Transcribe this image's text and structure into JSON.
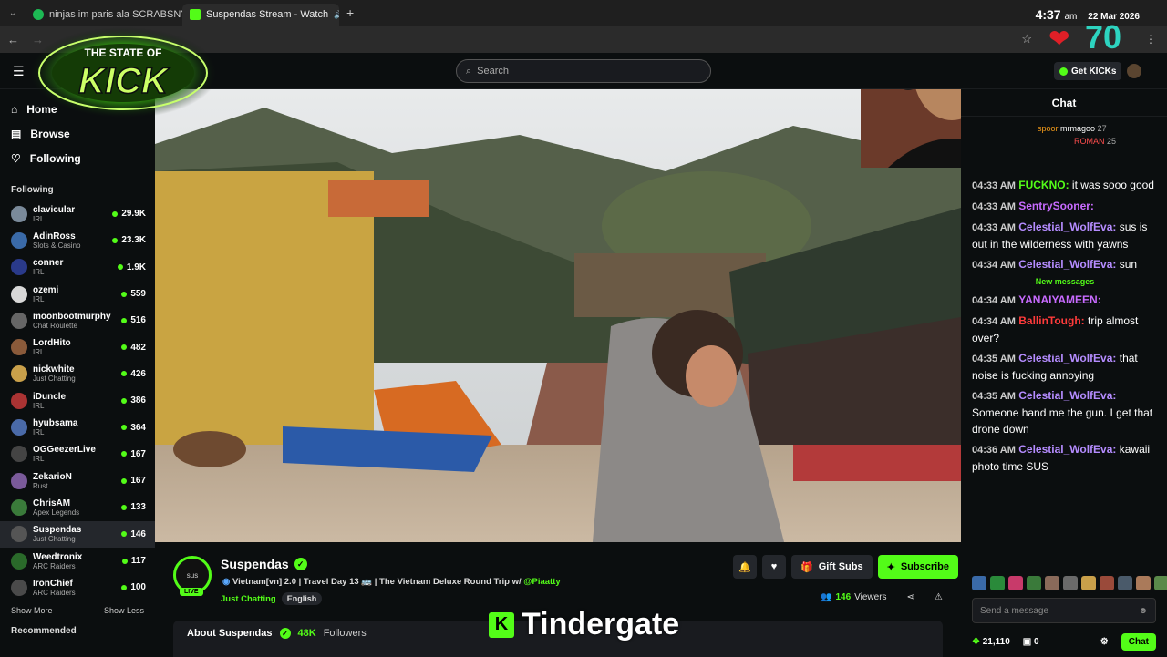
{
  "browser": {
    "tabs": [
      {
        "label": "ninjas im paris ala SCRABSNYC",
        "active": false
      },
      {
        "label": "Suspendas Stream - Watch",
        "active": true
      }
    ],
    "new_tab": "+"
  },
  "overlay": {
    "clock_time": "4:37",
    "clock_ampm": "am",
    "clock_date": "22 Mar 2026",
    "heart_count": "70",
    "logo_top": "THE STATE OF",
    "logo_main": "KICK",
    "tindergate": "Tindergate"
  },
  "header": {
    "search_placeholder": "Search",
    "get_kicks": "Get KICKs"
  },
  "sidebar": {
    "nav": [
      {
        "label": "Home",
        "icon": "home-icon"
      },
      {
        "label": "Browse",
        "icon": "browse-icon"
      },
      {
        "label": "Following",
        "icon": "heart-icon"
      }
    ],
    "following_title": "Following",
    "following": [
      {
        "name": "clavicular",
        "category": "IRL",
        "viewers": "29.9K"
      },
      {
        "name": "AdinRoss",
        "category": "Slots & Casino",
        "viewers": "23.3K"
      },
      {
        "name": "conner",
        "category": "IRL",
        "viewers": "1.9K"
      },
      {
        "name": "ozemi",
        "category": "IRL",
        "viewers": "559"
      },
      {
        "name": "moonbootmurphy",
        "category": "Chat Roulette",
        "viewers": "516"
      },
      {
        "name": "LordHito",
        "category": "IRL",
        "viewers": "482"
      },
      {
        "name": "nickwhite",
        "category": "Just Chatting",
        "viewers": "426"
      },
      {
        "name": "iDuncle",
        "category": "IRL",
        "viewers": "386"
      },
      {
        "name": "hyubsama",
        "category": "IRL",
        "viewers": "364"
      },
      {
        "name": "OGGeezerLive",
        "category": "IRL",
        "viewers": "167"
      },
      {
        "name": "ZekarioN",
        "category": "Rust",
        "viewers": "167"
      },
      {
        "name": "ChrisAM",
        "category": "Apex Legends",
        "viewers": "133"
      },
      {
        "name": "Suspendas",
        "category": "Just Chatting",
        "viewers": "146"
      },
      {
        "name": "Weedtronix",
        "category": "ARC Raiders",
        "viewers": "117"
      },
      {
        "name": "IronChief",
        "category": "ARC Raiders",
        "viewers": "100"
      }
    ],
    "show_more": "Show More",
    "show_less": "Show Less",
    "recommended_title": "Recommended"
  },
  "stream": {
    "channel": "Suspendas",
    "live_badge": "LIVE",
    "title_text": "Vietnam[vn] 2.0 | Travel Day 13 🚌 | The Vietnam Deluxe Round Trip w/",
    "title_mention": "@Piaatty",
    "category": "Just Chatting",
    "tag": "English",
    "gift_subs": "Gift Subs",
    "subscribe": "Subscribe",
    "viewers": "146",
    "viewers_label": "Viewers",
    "about_title": "About Suspendas",
    "followers": "48K",
    "followers_label": "Followers"
  },
  "chat": {
    "title": "Chat",
    "pinned": [
      {
        "user": "spoor",
        "name": "mrmagoo",
        "count": "27"
      },
      {
        "user": "",
        "name": "ROMAN",
        "count": "25"
      }
    ],
    "messages": [
      {
        "time": "04:33 AM",
        "user": "FUCKNO",
        "color": "#53fc18",
        "text": "it was sooo good"
      },
      {
        "time": "04:33 AM",
        "user": "SentrySooner",
        "color": "#c86bff",
        "text": ""
      },
      {
        "time": "04:33 AM",
        "user": "Celestial_WolfEva",
        "color": "#b58cff",
        "text": "sus is out in the wilderness with yawns"
      },
      {
        "time": "04:34 AM",
        "user": "Celestial_WolfEva",
        "color": "#b58cff",
        "text": "sun"
      }
    ],
    "new_messages": "New messages",
    "messages2": [
      {
        "time": "04:34 AM",
        "user": "YANAIYAMEEN",
        "color": "#c86bff",
        "text": ""
      },
      {
        "time": "04:34 AM",
        "user": "BallinTough",
        "color": "#ff3b3b",
        "text": "trip almost over?"
      },
      {
        "time": "04:35 AM",
        "user": "Celestial_WolfEva",
        "color": "#b58cff",
        "text": "that noise is fucking annoying"
      },
      {
        "time": "04:35 AM",
        "user": "Celestial_WolfEva",
        "color": "#b58cff",
        "text": "Someone hand me the gun. I get that drone down"
      },
      {
        "time": "04:36 AM",
        "user": "Celestial_WolfEva",
        "color": "#b58cff",
        "text": "kawaii photo time SUS"
      }
    ],
    "send_placeholder": "Send a message",
    "kicks_balance": "21,110",
    "other_balance": "0",
    "chat_button": "Chat"
  },
  "colors": {
    "accent": "#53fc18",
    "bg": "#0b0e0f",
    "panel": "#191b1f"
  }
}
